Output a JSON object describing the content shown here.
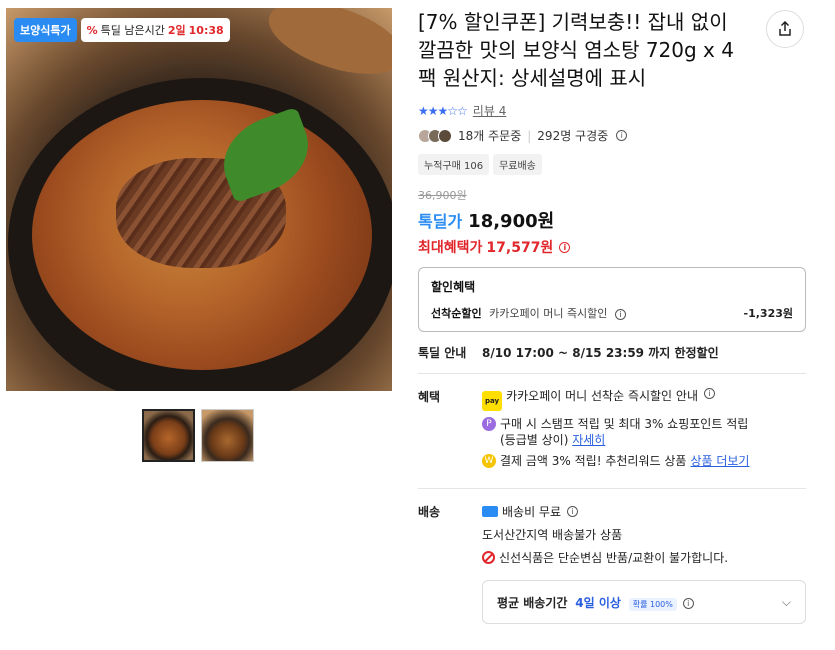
{
  "gallery": {
    "badge_label": "보양식특가",
    "timer_prefix": "특딜 남은시간",
    "timer_days": "2일",
    "timer_time": "10:38",
    "timer_icon": "percent-icon"
  },
  "product": {
    "title": "[7% 할인쿠폰] 기력보충!! 잡내 없이 깔끔한 맛의 보양식 염소탕 720g x 4팩 원산지: 상세설명에 표시",
    "review_label": "리뷰 4",
    "rating": 3.5,
    "orders_text": "18개 주문중",
    "buyers_text": "292명 구경중",
    "tags": [
      "누적구매 106",
      "무료배송"
    ]
  },
  "price": {
    "original": "36,900원",
    "deal_label": "톡딜가",
    "deal_price": "18,900원",
    "max_label": "최대혜택가",
    "max_price": "17,577원"
  },
  "discount": {
    "title": "할인혜택",
    "line_label": "선착순할인",
    "line_desc": "카카오페이 머니 즉시할인",
    "line_value": "-1,323원"
  },
  "deal": {
    "label": "톡딜 안내",
    "value": "8/10 17:00 ~ 8/15 23:59 까지 한정할인"
  },
  "benefit": {
    "label": "혜택",
    "kpay_text": "pay",
    "item1": "카카오페이 머니 선착순 즉시할인 안내",
    "item2_a": "구매 시 스탬프 적립 및 최대 3% 쇼핑포인트 적립",
    "item2_b": "(등급별 상이)",
    "item2_link": "자세히",
    "item3": "결제 금액 3% 적립! 추천리워드 상품",
    "item3_link": "상품 더보기",
    "p_glyph": "P",
    "w_glyph": "W"
  },
  "shipping": {
    "label": "배송",
    "fee": "배송비 무료",
    "island": "도서산간지역 배송불가 상품",
    "notice": "신선식품은 단순변심 반품/교환이 불가합니다.",
    "avg_label": "평균 배송기간",
    "avg_days": "4일 이상",
    "avg_prob": "확률 100%"
  }
}
